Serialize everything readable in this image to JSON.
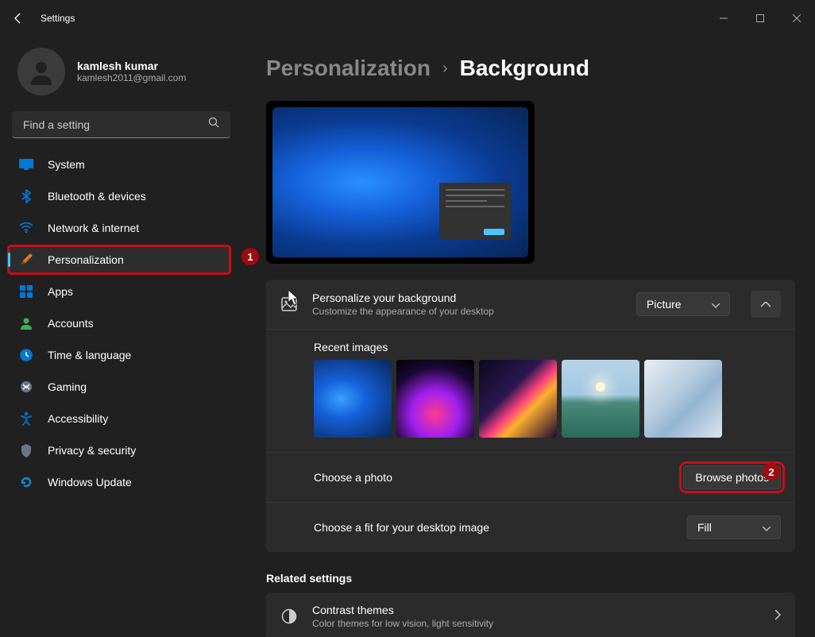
{
  "app": {
    "title": "Settings"
  },
  "user": {
    "name": "kamlesh kumar",
    "email": "kamlesh2011@gmail.com"
  },
  "search": {
    "placeholder": "Find a setting"
  },
  "nav": {
    "items": [
      {
        "label": "System"
      },
      {
        "label": "Bluetooth & devices"
      },
      {
        "label": "Network & internet"
      },
      {
        "label": "Personalization"
      },
      {
        "label": "Apps"
      },
      {
        "label": "Accounts"
      },
      {
        "label": "Time & language"
      },
      {
        "label": "Gaming"
      },
      {
        "label": "Accessibility"
      },
      {
        "label": "Privacy & security"
      },
      {
        "label": "Windows Update"
      }
    ]
  },
  "breadcrumb": {
    "parent": "Personalization",
    "current": "Background"
  },
  "personalize": {
    "title": "Personalize your background",
    "subtitle": "Customize the appearance of your desktop",
    "dropdown_value": "Picture"
  },
  "recent": {
    "label": "Recent images"
  },
  "choose_photo": {
    "label": "Choose a photo",
    "button": "Browse photos"
  },
  "choose_fit": {
    "label": "Choose a fit for your desktop image",
    "dropdown_value": "Fill"
  },
  "related": {
    "heading": "Related settings",
    "contrast_title": "Contrast themes",
    "contrast_sub": "Color themes for low vision, light sensitivity"
  },
  "annotations": {
    "one": "1",
    "two": "2"
  }
}
